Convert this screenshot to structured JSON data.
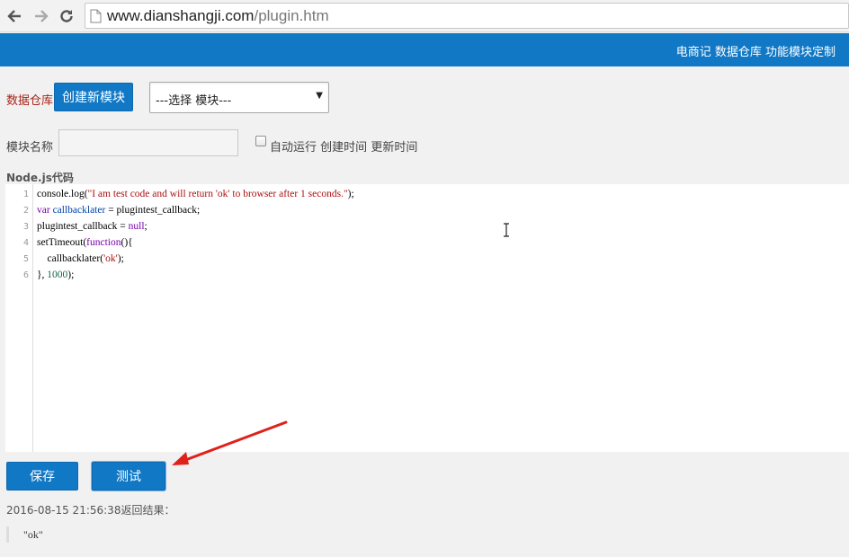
{
  "browser": {
    "url_host": "www.dianshangji.com",
    "url_path": "/plugin.htm"
  },
  "header": {
    "title": "电商记 数据仓库 功能模块定制",
    "bg_color": "#1178c6"
  },
  "toolbar": {
    "repo_label": "数据仓库",
    "create_button": "创建新模块",
    "module_select": "---选择 模块---"
  },
  "form": {
    "name_label": "模块名称",
    "name_value": "",
    "auto_run_label": "自动运行",
    "created_label": "创建时间",
    "updated_label": "更新时间",
    "code_label": "Node.js代码"
  },
  "editor": {
    "line_numbers": [
      "1",
      "2",
      "3",
      "4",
      "5",
      "6"
    ],
    "lines": [
      "console.log(\"I am test code and will return 'ok' to browser after 1 seconds.\");",
      "var callbacklater = plugintest_callback;",
      "plugintest_callback = null;",
      "setTimeout(function(){",
      "    callbacklater('ok');",
      "}, 1000);"
    ]
  },
  "actions": {
    "save_button": "保存",
    "test_button": "测试"
  },
  "result": {
    "label": "2016-08-15 21:56:38返回结果：",
    "value": "\"ok\""
  },
  "annotation": {
    "arrow_color": "#e0201b"
  }
}
